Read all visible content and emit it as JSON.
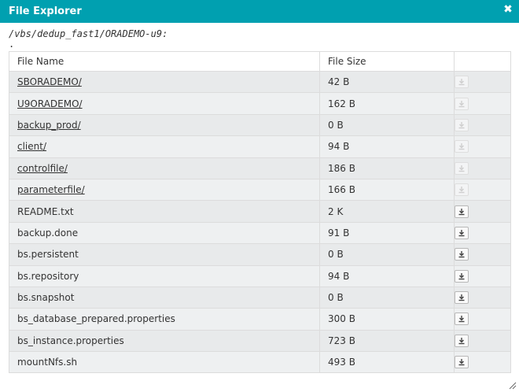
{
  "window": {
    "title": "File Explorer"
  },
  "path": "/vbs/dedup_fast1/ORADEMO-u9:",
  "current_dir_entry": ".",
  "table": {
    "headers": {
      "name": "File Name",
      "size": "File Size",
      "action": ""
    },
    "rows": [
      {
        "name": "SBORADEMO/",
        "size": "42 B",
        "is_dir": true
      },
      {
        "name": "U9ORADEMO/",
        "size": "162 B",
        "is_dir": true
      },
      {
        "name": "backup_prod/",
        "size": "0 B",
        "is_dir": true
      },
      {
        "name": "client/",
        "size": "94 B",
        "is_dir": true
      },
      {
        "name": "controlfile/",
        "size": "186 B",
        "is_dir": true
      },
      {
        "name": "parameterfile/",
        "size": "166 B",
        "is_dir": true
      },
      {
        "name": "README.txt",
        "size": "2 K",
        "is_dir": false
      },
      {
        "name": "backup.done",
        "size": "91 B",
        "is_dir": false
      },
      {
        "name": "bs.persistent",
        "size": "0 B",
        "is_dir": false
      },
      {
        "name": "bs.repository",
        "size": "94 B",
        "is_dir": false
      },
      {
        "name": "bs.snapshot",
        "size": "0 B",
        "is_dir": false
      },
      {
        "name": "bs_database_prepared.properties",
        "size": "300 B",
        "is_dir": false
      },
      {
        "name": "bs_instance.properties",
        "size": "723 B",
        "is_dir": false
      },
      {
        "name": "mountNfs.sh",
        "size": "493 B",
        "is_dir": false
      }
    ]
  },
  "icons": {
    "close": "close-icon",
    "download": "download-icon",
    "resize": "resize-grip-icon"
  },
  "colors": {
    "titlebar": "#00a0b0",
    "row_odd": "#e8eaeb",
    "row_even": "#eef0f1"
  }
}
